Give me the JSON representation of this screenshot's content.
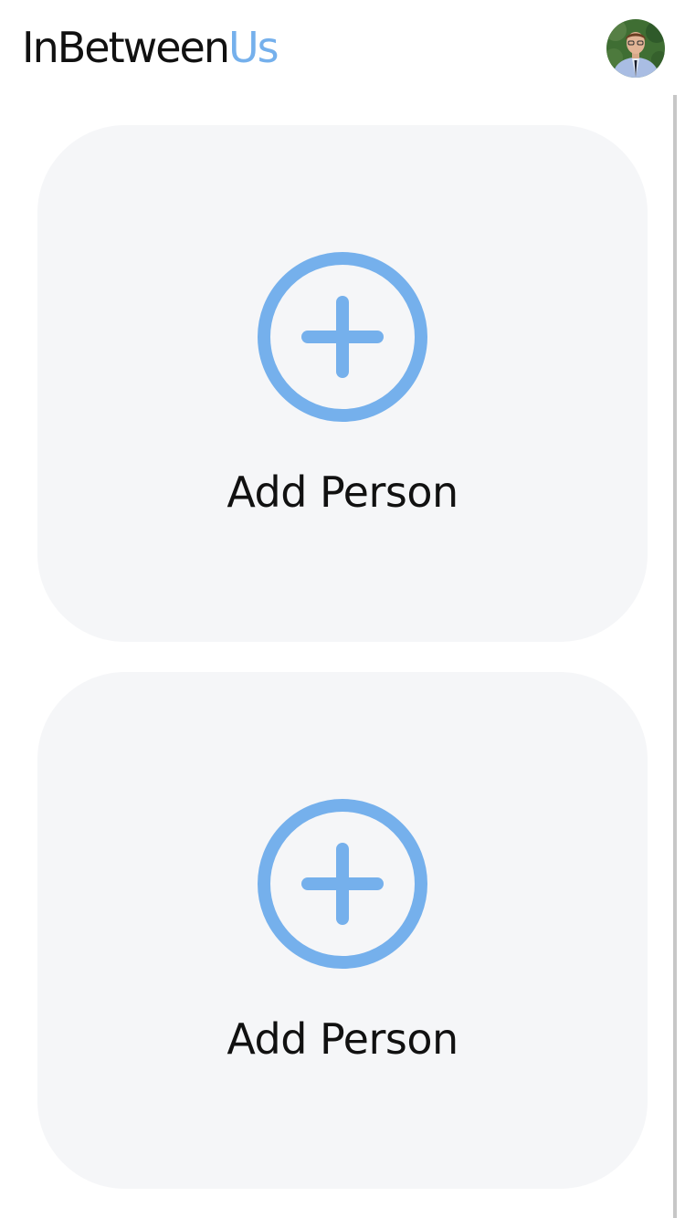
{
  "header": {
    "title_part1": "InBetween",
    "title_part2": "Us",
    "avatar_icon": "user-avatar-photo"
  },
  "cards": [
    {
      "label": "Add Person",
      "icon": "plus-circle-icon"
    },
    {
      "label": "Add Person",
      "icon": "plus-circle-icon"
    }
  ],
  "colors": {
    "accent": "#75b0ec",
    "card_background": "#f5f6f8",
    "text": "#111111"
  }
}
